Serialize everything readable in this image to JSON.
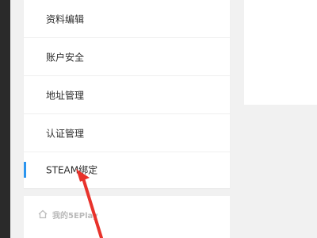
{
  "sidebar": {
    "items": [
      {
        "label": "资料编辑"
      },
      {
        "label": "账户安全"
      },
      {
        "label": "地址管理"
      },
      {
        "label": "认证管理"
      },
      {
        "label": "STEAM绑定"
      }
    ],
    "active_index": 4
  },
  "section": {
    "title": "我的5EPlay",
    "icon": "home-icon"
  },
  "colors": {
    "active_indicator": "#2b95ef",
    "annotation_arrow": "#e8322b"
  }
}
